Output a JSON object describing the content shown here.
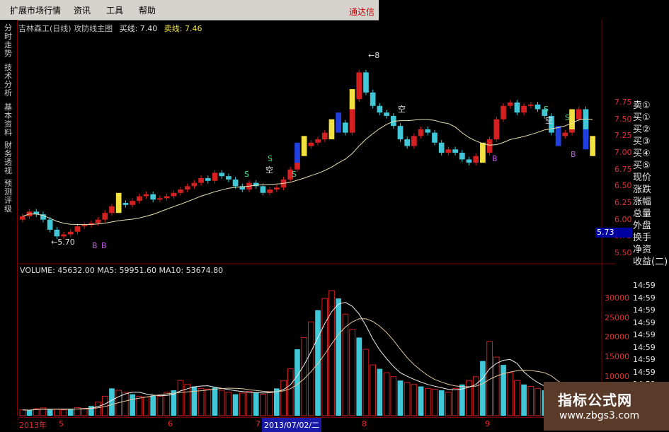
{
  "menu": {
    "items": [
      "扩展市场行情",
      "资讯",
      "工具",
      "帮助"
    ],
    "brand": "通达信"
  },
  "left_tabs": [
    "分时走势",
    "技术分析",
    "基本资料",
    "财务透视",
    "预测评级"
  ],
  "price_panel": {
    "title": "吉林森工(日线) 攻防线主图",
    "buy_line_label": "买线: 7.40",
    "sell_line_label": "卖线: 7.46",
    "axis_ticks": [
      "7.75",
      "7.50",
      "7.25",
      "7.00",
      "6.75",
      "6.50",
      "6.25",
      "6.00",
      "5.75",
      "5.50"
    ],
    "low_label": "5.70",
    "high_label": "8",
    "current_price": "5.73",
    "signal_labels": [
      "S",
      "S",
      "S",
      "S",
      "S",
      "B",
      "B",
      "B",
      "B",
      "空",
      "空",
      "空"
    ]
  },
  "volume_panel": {
    "title": "VOLUME: 45632.00  MA5: 59951.60  MA10: 53674.80",
    "axis_ticks": [
      "30000",
      "25000",
      "20000",
      "15000",
      "10000",
      "5000"
    ]
  },
  "right_panel": {
    "items": [
      "卖①",
      "买①",
      "买②",
      "买③",
      "买④",
      "买⑤",
      "现价",
      "涨跌",
      "涨幅",
      "总量",
      "外盘",
      "换手",
      "净资",
      "收益(二)"
    ],
    "times": [
      "14:59",
      "14:59",
      "14:59",
      "14:59",
      "14:59",
      "14:59",
      "14:59",
      "14:59",
      "14:59",
      "14:59"
    ]
  },
  "date_axis": {
    "labels": [
      "2013年",
      "5",
      "6",
      "7",
      "8",
      "9"
    ],
    "cursor_date": "2013/07/02/二"
  },
  "watermark": {
    "title": "指标公式网",
    "url": "www.zbgs3.com"
  },
  "colors": {
    "up": "#d42020",
    "down": "#40c8d8",
    "signal_yellow": "#f0e040",
    "signal_blue": "#2040e0",
    "ma_line": "#e8e0b0",
    "axis_red": "#e03030"
  },
  "chart_data": {
    "type": "candlestick",
    "close_series_approx": [
      6.05,
      6.12,
      6.08,
      6.0,
      5.85,
      5.75,
      5.78,
      5.82,
      5.9,
      5.92,
      5.95,
      6.0,
      6.1,
      6.2,
      6.25,
      6.22,
      6.28,
      6.35,
      6.38,
      6.3,
      6.32,
      6.35,
      6.4,
      6.45,
      6.5,
      6.55,
      6.62,
      6.58,
      6.7,
      6.65,
      6.6,
      6.5,
      6.45,
      6.55,
      6.5,
      6.4,
      6.45,
      6.48,
      6.6,
      6.75,
      7.0,
      7.1,
      7.15,
      7.2,
      7.3,
      7.35,
      7.45,
      7.3,
      7.8,
      8.2,
      7.9,
      7.7,
      7.6,
      7.55,
      7.4,
      7.2,
      7.1,
      7.25,
      7.35,
      7.3,
      7.15,
      7.0,
      7.05,
      7.0,
      6.9,
      6.85,
      6.95,
      7.0,
      7.2,
      7.5,
      7.7,
      7.75,
      7.6,
      7.7,
      7.72,
      7.65,
      7.55,
      7.3,
      7.25,
      7.3,
      7.5,
      7.65,
      7.2,
      7.1
    ],
    "volume_series_approx": [
      1500,
      1400,
      1800,
      2000,
      1600,
      1700,
      1500,
      1800,
      2100,
      1900,
      2500,
      3500,
      5000,
      7000,
      6500,
      6000,
      5500,
      5000,
      4800,
      5200,
      5000,
      6000,
      6500,
      9000,
      8000,
      7500,
      7000,
      6800,
      7200,
      6500,
      6000,
      5500,
      5800,
      6200,
      6000,
      5500,
      6000,
      7000,
      9000,
      12000,
      17000,
      20000,
      24000,
      27000,
      30000,
      32000,
      30000,
      26000,
      22000,
      20000,
      17000,
      13000,
      12000,
      11000,
      10000,
      9000,
      8500,
      8000,
      7500,
      7000,
      6800,
      6500,
      6000,
      7000,
      8000,
      9000,
      10000,
      14000,
      19000,
      15000,
      13000,
      11000,
      9000,
      8000,
      7500,
      7000,
      6500,
      6000,
      5500,
      5000,
      8500,
      7000,
      6000,
      5000
    ],
    "price_ylim": [
      5.45,
      7.85
    ],
    "volume_ylim": [
      0,
      34000
    ]
  }
}
